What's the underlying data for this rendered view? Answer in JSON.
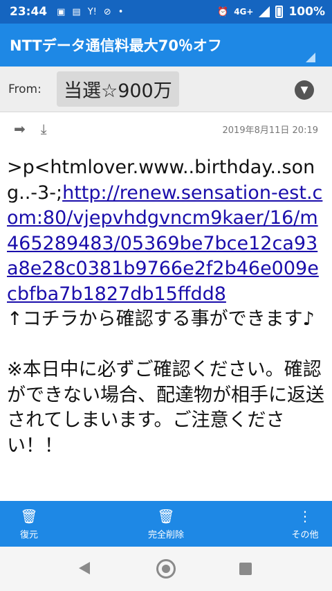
{
  "status": {
    "time": "23:44",
    "icons": [
      "image-icon",
      "news-icon",
      "yahoo-icon",
      "wifi-off-icon",
      "dot-icon"
    ],
    "network": "4G+",
    "battery": "100%"
  },
  "mail": {
    "subject": "NTTデータ通信料最大70％オフ",
    "from_label": "From:",
    "from_name": "当選☆900万",
    "date": "2019年8月11日 20:19",
    "body_prefix": ">p<htmlover.www..birthday..song..-3-;",
    "link": "http://renew.sensation-est.com:80/vjepvhdgvncm9kaer/16/m465289483/05369be7bce12ca93a8e28c0381b9766e2f2b46e009ecbfba7b1827db15ffdd8",
    "body_line1": "↑コチラから確認する事ができます♪",
    "body_line2": "※本日中に必ずご確認ください。確認ができない場合、配達物が相手に返送されてしまいます。ご注意ください！！"
  },
  "bottom": {
    "restore": "復元",
    "delete": "完全削除",
    "more": "その他"
  }
}
